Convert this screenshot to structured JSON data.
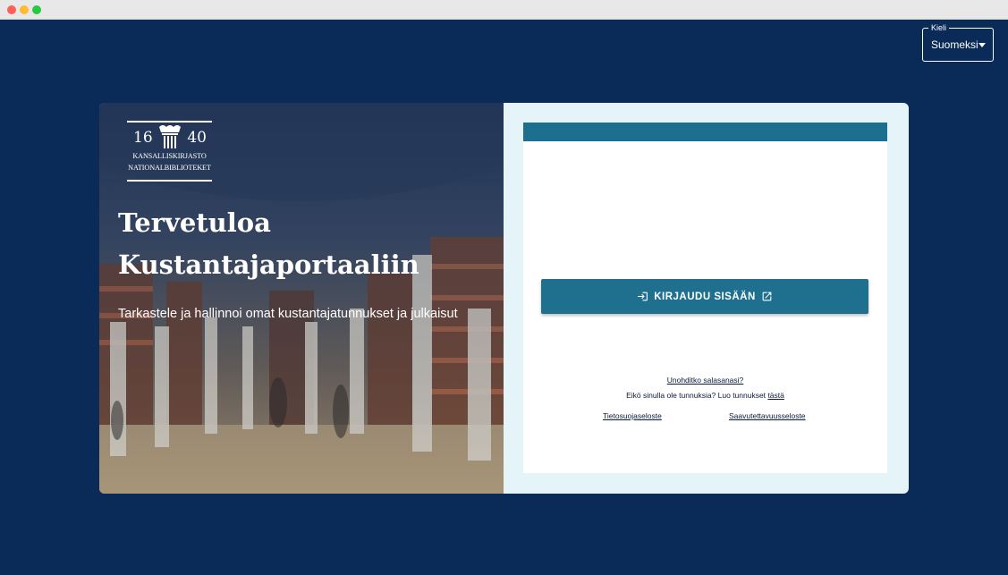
{
  "language": {
    "legend": "Kieli",
    "selected": "Suomeksi"
  },
  "hero": {
    "logo": {
      "year_left": "16",
      "year_right": "40",
      "line1": "KANSALLISKIRJASTO",
      "line2": "NATIONALBIBLIOTEKET"
    },
    "title_line1": "Tervetuloa",
    "title_line2": "Kustantajaportaaliin",
    "subtitle": "Tarkastele ja hallinnoi omat kustantajatunnukset ja julkaisut"
  },
  "login": {
    "button_label": "KIRJAUDU SISÄÄN",
    "forgot_password": "Unohditko salasanasi?",
    "no_account_text": "Eikö sinulla ole tunnuksia? Luo tunnukset",
    "register_link": "tästä",
    "privacy_link": "Tietosuojaseloste",
    "accessibility_link": "Saavutettavuusseloste"
  },
  "colors": {
    "page_background": "#0a2a57",
    "accent": "#1f6f8f",
    "panel_background": "#e5f4f9"
  },
  "icons": {
    "login": "login-icon",
    "external": "external-link-icon",
    "dropdown": "chevron-down-icon"
  }
}
